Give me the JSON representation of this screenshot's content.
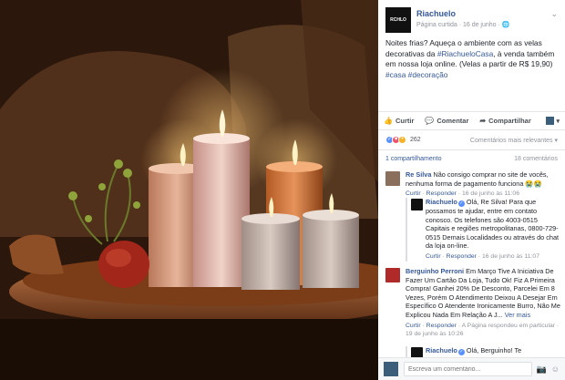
{
  "post": {
    "logo_text": "RCHLO",
    "page_name": "Riachuelo",
    "meta": "Página curtida · 16 de junho · ",
    "text_before": "Noites frias? Aqueça o ambiente com as velas decorativas da ",
    "hashtag_main": "#RiachueloCasa",
    "text_after": ", à venda também em nossa loja online. (Velas a partir de R$ 19,90)",
    "hashtags_end": "#casa #decoração"
  },
  "actions": {
    "like": "Curtir",
    "comment": "Comentar",
    "share": "Compartilhar"
  },
  "reactions": {
    "count": "262",
    "filter": "Comentários mais relevantes ▾"
  },
  "counts": {
    "shares": "1 compartilhamento",
    "comments": "18 comentários"
  },
  "comments": [
    {
      "name": "Re Silva",
      "text": "Não consigo comprar no site de vocês, nenhuma forma de pagamento funciona 😭😭",
      "like": "Curtir",
      "reply": "Responder",
      "time": "16 de junho às 11:06"
    },
    {
      "name": "Riachuelo",
      "text": "Olá, Re Silva! Para que possamos te ajudar, entre em contato conosco. Os telefones são 4003-0515 Capitais e regiões metropolitanas, 0800-729-0515 Demais Localidades ou através do chat da loja on-line.",
      "like": "Curtir",
      "reply": "Responder",
      "time": "16 de junho às 11:07"
    },
    {
      "name": "Berguinho Perroni",
      "text": "Em Março Tive A Iniciativa De Fazer Um Cartão Da Loja, Tudo Ok! Fiz A Primeira Compra! Ganhei 20% De Desconto, Parcelei Em 8 Vezes, Porém O Atendimento Deixou A Desejar Em Específico O Atendente Ironicamente Burro, Não Me Explicou Nada Em Relação A J...",
      "more": "Ver mais",
      "like": "Curtir",
      "reply": "Responder",
      "note": "A Página respondeu em particular",
      "time": "19 de junho às 10:26"
    },
    {
      "name": "Riachuelo",
      "text": "Olá, Berguinho! Te"
    }
  ],
  "composer": {
    "placeholder": "Escreva um comentário..."
  },
  "colors": {
    "link": "#365899",
    "muted": "#90949c"
  }
}
